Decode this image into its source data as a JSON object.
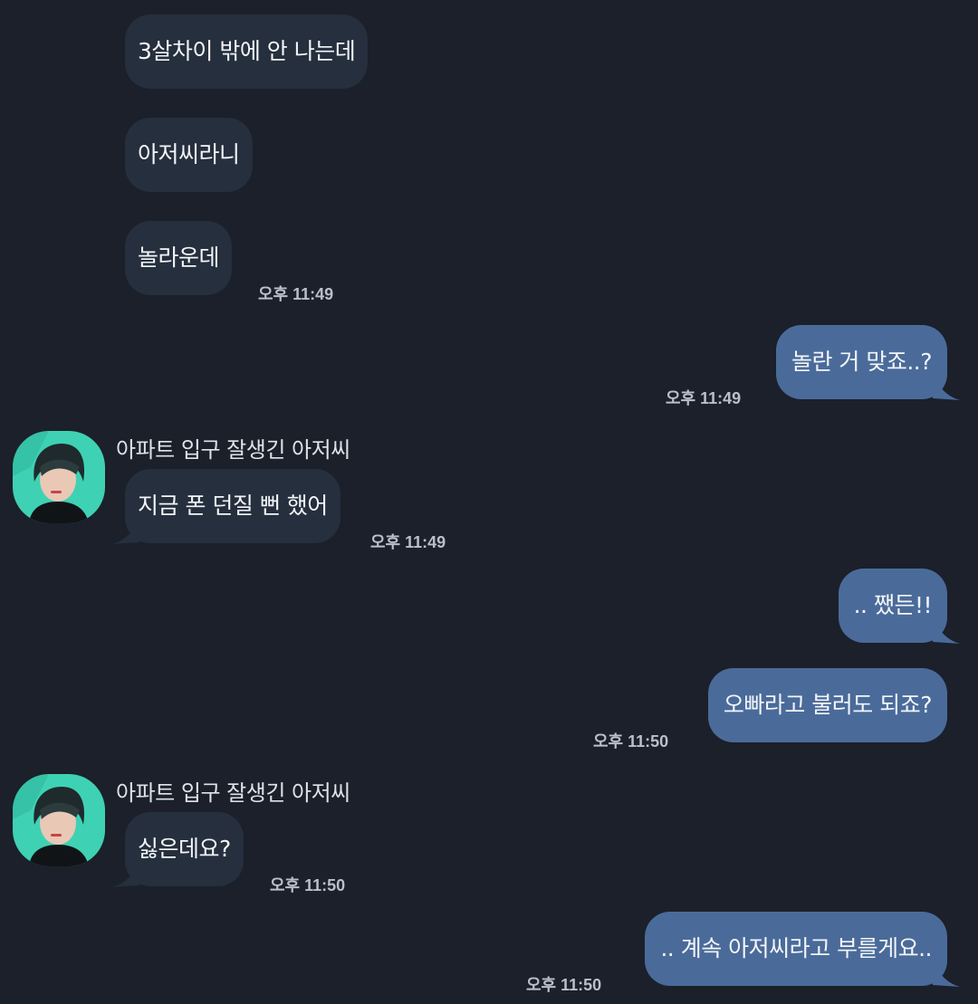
{
  "colors": {
    "background": "#1b202a",
    "incoming_bubble": "#252f3d",
    "outgoing_bubble": "#4a6b9a",
    "timestamp": "#b9c0ca",
    "avatar_bg": "#3fd1b4"
  },
  "messages": [
    {
      "side": "in",
      "text": "3살차이 밖에 안 나는데"
    },
    {
      "side": "in",
      "text": "아저씨라니"
    },
    {
      "side": "in",
      "text": "놀라운데",
      "time": "오후 11:49"
    },
    {
      "side": "out",
      "text": "놀란 거 맞죠..?",
      "time": "오후 11:49"
    },
    {
      "side": "in",
      "sender": "아파트 입구 잘생긴 아저씨",
      "avatar_icon": "profile-photo-icon",
      "text": "지금 폰 던질 뻔 했어",
      "time": "오후 11:49"
    },
    {
      "side": "out",
      "text": ".. 쨌든!!"
    },
    {
      "side": "out",
      "text": "오빠라고 불러도 되죠?",
      "time": "오후 11:50"
    },
    {
      "side": "in",
      "sender": "아파트 입구 잘생긴 아저씨",
      "avatar_icon": "profile-photo-icon",
      "text": "싫은데요?",
      "time": "오후 11:50"
    },
    {
      "side": "out",
      "text": ".. 계속 아저씨라고 부를게요..",
      "time": "오후 11:50"
    }
  ]
}
